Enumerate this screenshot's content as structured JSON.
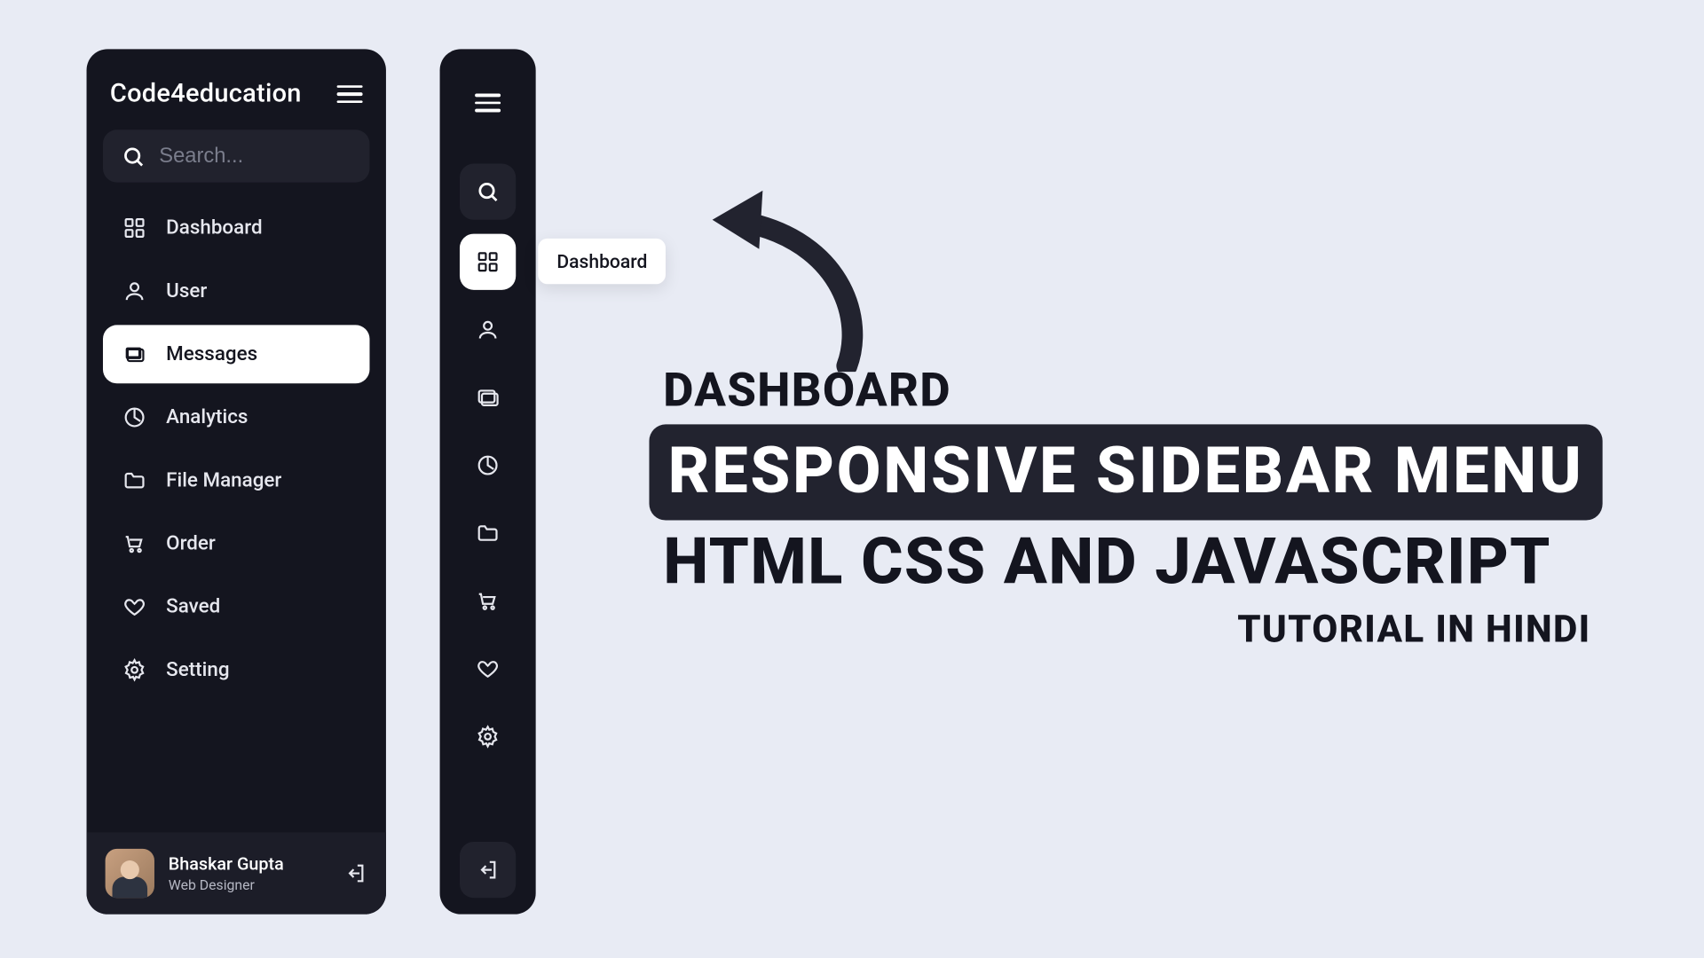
{
  "brand": "Code4education",
  "search": {
    "placeholder": "Search..."
  },
  "nav": {
    "items": [
      {
        "key": "dashboard",
        "label": "Dashboard"
      },
      {
        "key": "user",
        "label": "User"
      },
      {
        "key": "messages",
        "label": "Messages"
      },
      {
        "key": "analytics",
        "label": "Analytics"
      },
      {
        "key": "file-manager",
        "label": "File Manager"
      },
      {
        "key": "order",
        "label": "Order"
      },
      {
        "key": "saved",
        "label": "Saved"
      },
      {
        "key": "setting",
        "label": "Setting"
      }
    ],
    "active_expanded": "messages",
    "active_collapsed": "dashboard"
  },
  "user": {
    "name": "Bhaskar Gupta",
    "role": "Web Designer"
  },
  "collapsed_tooltip": "Dashboard",
  "headline": {
    "line1": "DASHBOARD",
    "line2": "RESPONSIVE SIDEBAR MENU",
    "line3": "HTML CSS AND JAVASCRIPT",
    "line4": "TUTORIAL IN HINDI"
  }
}
